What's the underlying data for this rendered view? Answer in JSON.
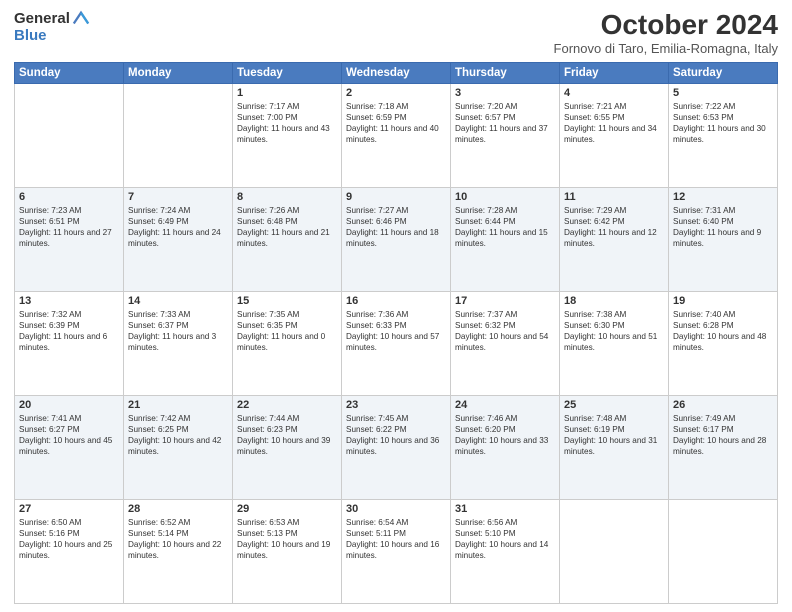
{
  "header": {
    "logo_general": "General",
    "logo_blue": "Blue",
    "month_title": "October 2024",
    "location": "Fornovo di Taro, Emilia-Romagna, Italy"
  },
  "weekdays": [
    "Sunday",
    "Monday",
    "Tuesday",
    "Wednesday",
    "Thursday",
    "Friday",
    "Saturday"
  ],
  "weeks": [
    [
      {
        "day": "",
        "sunrise": "",
        "sunset": "",
        "daylight": ""
      },
      {
        "day": "",
        "sunrise": "",
        "sunset": "",
        "daylight": ""
      },
      {
        "day": "1",
        "sunrise": "Sunrise: 7:17 AM",
        "sunset": "Sunset: 7:00 PM",
        "daylight": "Daylight: 11 hours and 43 minutes."
      },
      {
        "day": "2",
        "sunrise": "Sunrise: 7:18 AM",
        "sunset": "Sunset: 6:59 PM",
        "daylight": "Daylight: 11 hours and 40 minutes."
      },
      {
        "day": "3",
        "sunrise": "Sunrise: 7:20 AM",
        "sunset": "Sunset: 6:57 PM",
        "daylight": "Daylight: 11 hours and 37 minutes."
      },
      {
        "day": "4",
        "sunrise": "Sunrise: 7:21 AM",
        "sunset": "Sunset: 6:55 PM",
        "daylight": "Daylight: 11 hours and 34 minutes."
      },
      {
        "day": "5",
        "sunrise": "Sunrise: 7:22 AM",
        "sunset": "Sunset: 6:53 PM",
        "daylight": "Daylight: 11 hours and 30 minutes."
      }
    ],
    [
      {
        "day": "6",
        "sunrise": "Sunrise: 7:23 AM",
        "sunset": "Sunset: 6:51 PM",
        "daylight": "Daylight: 11 hours and 27 minutes."
      },
      {
        "day": "7",
        "sunrise": "Sunrise: 7:24 AM",
        "sunset": "Sunset: 6:49 PM",
        "daylight": "Daylight: 11 hours and 24 minutes."
      },
      {
        "day": "8",
        "sunrise": "Sunrise: 7:26 AM",
        "sunset": "Sunset: 6:48 PM",
        "daylight": "Daylight: 11 hours and 21 minutes."
      },
      {
        "day": "9",
        "sunrise": "Sunrise: 7:27 AM",
        "sunset": "Sunset: 6:46 PM",
        "daylight": "Daylight: 11 hours and 18 minutes."
      },
      {
        "day": "10",
        "sunrise": "Sunrise: 7:28 AM",
        "sunset": "Sunset: 6:44 PM",
        "daylight": "Daylight: 11 hours and 15 minutes."
      },
      {
        "day": "11",
        "sunrise": "Sunrise: 7:29 AM",
        "sunset": "Sunset: 6:42 PM",
        "daylight": "Daylight: 11 hours and 12 minutes."
      },
      {
        "day": "12",
        "sunrise": "Sunrise: 7:31 AM",
        "sunset": "Sunset: 6:40 PM",
        "daylight": "Daylight: 11 hours and 9 minutes."
      }
    ],
    [
      {
        "day": "13",
        "sunrise": "Sunrise: 7:32 AM",
        "sunset": "Sunset: 6:39 PM",
        "daylight": "Daylight: 11 hours and 6 minutes."
      },
      {
        "day": "14",
        "sunrise": "Sunrise: 7:33 AM",
        "sunset": "Sunset: 6:37 PM",
        "daylight": "Daylight: 11 hours and 3 minutes."
      },
      {
        "day": "15",
        "sunrise": "Sunrise: 7:35 AM",
        "sunset": "Sunset: 6:35 PM",
        "daylight": "Daylight: 11 hours and 0 minutes."
      },
      {
        "day": "16",
        "sunrise": "Sunrise: 7:36 AM",
        "sunset": "Sunset: 6:33 PM",
        "daylight": "Daylight: 10 hours and 57 minutes."
      },
      {
        "day": "17",
        "sunrise": "Sunrise: 7:37 AM",
        "sunset": "Sunset: 6:32 PM",
        "daylight": "Daylight: 10 hours and 54 minutes."
      },
      {
        "day": "18",
        "sunrise": "Sunrise: 7:38 AM",
        "sunset": "Sunset: 6:30 PM",
        "daylight": "Daylight: 10 hours and 51 minutes."
      },
      {
        "day": "19",
        "sunrise": "Sunrise: 7:40 AM",
        "sunset": "Sunset: 6:28 PM",
        "daylight": "Daylight: 10 hours and 48 minutes."
      }
    ],
    [
      {
        "day": "20",
        "sunrise": "Sunrise: 7:41 AM",
        "sunset": "Sunset: 6:27 PM",
        "daylight": "Daylight: 10 hours and 45 minutes."
      },
      {
        "day": "21",
        "sunrise": "Sunrise: 7:42 AM",
        "sunset": "Sunset: 6:25 PM",
        "daylight": "Daylight: 10 hours and 42 minutes."
      },
      {
        "day": "22",
        "sunrise": "Sunrise: 7:44 AM",
        "sunset": "Sunset: 6:23 PM",
        "daylight": "Daylight: 10 hours and 39 minutes."
      },
      {
        "day": "23",
        "sunrise": "Sunrise: 7:45 AM",
        "sunset": "Sunset: 6:22 PM",
        "daylight": "Daylight: 10 hours and 36 minutes."
      },
      {
        "day": "24",
        "sunrise": "Sunrise: 7:46 AM",
        "sunset": "Sunset: 6:20 PM",
        "daylight": "Daylight: 10 hours and 33 minutes."
      },
      {
        "day": "25",
        "sunrise": "Sunrise: 7:48 AM",
        "sunset": "Sunset: 6:19 PM",
        "daylight": "Daylight: 10 hours and 31 minutes."
      },
      {
        "day": "26",
        "sunrise": "Sunrise: 7:49 AM",
        "sunset": "Sunset: 6:17 PM",
        "daylight": "Daylight: 10 hours and 28 minutes."
      }
    ],
    [
      {
        "day": "27",
        "sunrise": "Sunrise: 6:50 AM",
        "sunset": "Sunset: 5:16 PM",
        "daylight": "Daylight: 10 hours and 25 minutes."
      },
      {
        "day": "28",
        "sunrise": "Sunrise: 6:52 AM",
        "sunset": "Sunset: 5:14 PM",
        "daylight": "Daylight: 10 hours and 22 minutes."
      },
      {
        "day": "29",
        "sunrise": "Sunrise: 6:53 AM",
        "sunset": "Sunset: 5:13 PM",
        "daylight": "Daylight: 10 hours and 19 minutes."
      },
      {
        "day": "30",
        "sunrise": "Sunrise: 6:54 AM",
        "sunset": "Sunset: 5:11 PM",
        "daylight": "Daylight: 10 hours and 16 minutes."
      },
      {
        "day": "31",
        "sunrise": "Sunrise: 6:56 AM",
        "sunset": "Sunset: 5:10 PM",
        "daylight": "Daylight: 10 hours and 14 minutes."
      },
      {
        "day": "",
        "sunrise": "",
        "sunset": "",
        "daylight": ""
      },
      {
        "day": "",
        "sunrise": "",
        "sunset": "",
        "daylight": ""
      }
    ]
  ]
}
